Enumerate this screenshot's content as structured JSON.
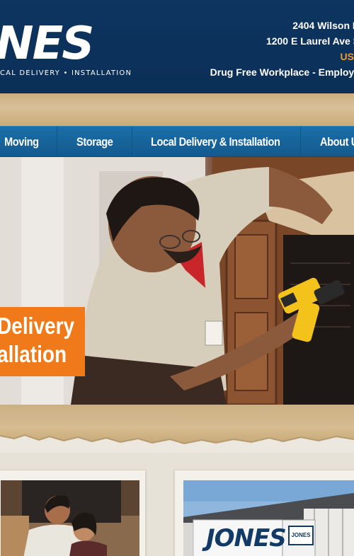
{
  "header": {
    "logo_text": "NES",
    "logo_tagline": "CAL DELIVERY • INSTALLATION",
    "address_1": "2404 Wilson R",
    "address_2": "1200 E Laurel Ave S",
    "highlight": "US",
    "notice": "Drug Free Workplace - Employe"
  },
  "nav": {
    "items": [
      {
        "label": "Moving"
      },
      {
        "label": "Storage"
      },
      {
        "label": "Local Delivery & Installation"
      },
      {
        "label": "About U"
      }
    ]
  },
  "hero": {
    "banner_line_1": "Delivery",
    "banner_line_2": "allation"
  },
  "cards": {
    "truck_logo": "JONES",
    "truck_badge": "JONES"
  },
  "colors": {
    "header_bg": "#0d3560",
    "nav_bg": "#1b6ea8",
    "accent_orange": "#f07a1a",
    "highlight_orange": "#f39a2b"
  }
}
